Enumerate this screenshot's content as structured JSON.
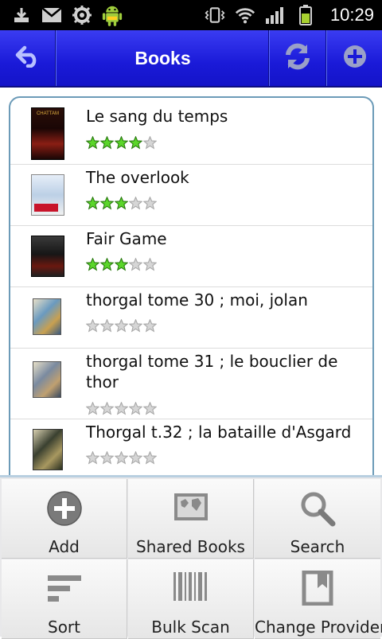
{
  "status_bar": {
    "time": "10:29",
    "left_icons": [
      "download-icon",
      "gmail-icon",
      "settings-icon",
      "android-icon"
    ],
    "right_icons": [
      "vibrate-icon",
      "wifi-icon",
      "signal-icon",
      "battery-icon"
    ]
  },
  "action_bar": {
    "title": "Books",
    "back_icon": "back-arrow-icon",
    "refresh_icon": "refresh-icon",
    "add_icon": "add-icon"
  },
  "books": [
    {
      "title": "Le sang du temps",
      "rating": 4,
      "max_rating": 5,
      "cover_colors": [
        "#1a0a08",
        "#b8281e"
      ]
    },
    {
      "title": "The overlook",
      "rating": 3,
      "max_rating": 5,
      "cover_colors": [
        "#dfe6f0",
        "#c8142a"
      ]
    },
    {
      "title": "Fair Game",
      "rating": 3,
      "max_rating": 5,
      "cover_colors": [
        "#2a2a2a",
        "#8a1a12"
      ]
    },
    {
      "title": "thorgal tome 30 ; moi, jolan",
      "rating": 0,
      "max_rating": 5,
      "cover_colors": [
        "#5a8ab0",
        "#d8b060"
      ]
    },
    {
      "title": "thorgal tome 31 ; le bouclier de thor",
      "rating": 0,
      "max_rating": 5,
      "cover_colors": [
        "#6a7a90",
        "#c0a070"
      ]
    },
    {
      "title": "Thorgal t.32 ; la bataille d'Asgard",
      "rating": 0,
      "max_rating": 5,
      "cover_colors": [
        "#3a4030",
        "#a89860"
      ]
    }
  ],
  "menu": {
    "items": [
      {
        "label": "Add",
        "icon": "add-circle-icon"
      },
      {
        "label": "Shared Books",
        "icon": "map-icon"
      },
      {
        "label": "Search",
        "icon": "search-icon"
      },
      {
        "label": "Sort",
        "icon": "sort-icon"
      },
      {
        "label": "Bulk Scan",
        "icon": "barcode-icon"
      },
      {
        "label": "Change Provider",
        "icon": "bookmark-icon"
      }
    ]
  },
  "colors": {
    "action_bar": "#1a1ad8",
    "star_filled": "#5bd62a",
    "star_empty": "#d6d6d6",
    "list_border": "#6c9bb8"
  }
}
